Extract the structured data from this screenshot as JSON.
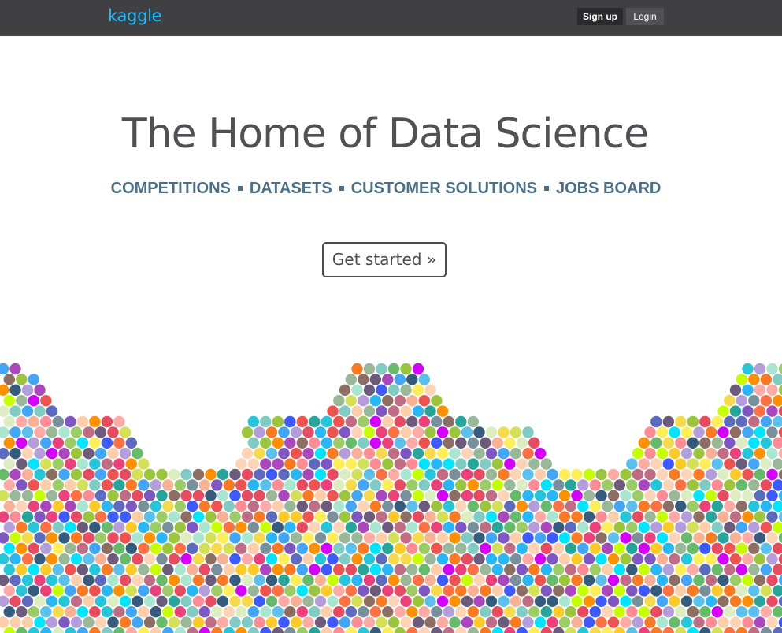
{
  "header": {
    "logo_text": "kaggle",
    "signup_label": "Sign up",
    "login_label": "Login",
    "brand_color": "#20beff",
    "bar_color": "#404043"
  },
  "hero": {
    "title": "The Home of Data Science",
    "nav_items": [
      "COMPETITIONS",
      "DATASETS",
      "CUSTOMER SOLUTIONS",
      "JOBS BOARD"
    ],
    "cta_label": "Get started »",
    "nav_color": "#4a6f86"
  },
  "decoration": {
    "name": "colorful-dot-hex-pattern",
    "palette": [
      "#e84a5f",
      "#f7d94c",
      "#5bc0eb",
      "#9bc53d",
      "#fa7921",
      "#c06c84",
      "#6c5b7b",
      "#355c7d",
      "#f8b195",
      "#99b898",
      "#feceab",
      "#a8e6cf",
      "#dcedc1",
      "#ffd3b6",
      "#ffaaa5",
      "#ff8b94",
      "#b39ddb",
      "#80cbc4",
      "#ef5350",
      "#42a5f5",
      "#66bb6a",
      "#ffee58",
      "#ab47bc",
      "#26c6da",
      "#d4e157",
      "#ff7043",
      "#8d6e63",
      "#78909c",
      "#ec407a",
      "#7e57c2",
      "#29b6f6",
      "#9ccc65",
      "#ffca28",
      "#5c6bc0",
      "#26a69a",
      "#d500f9",
      "#00e5ff",
      "#c6ff00",
      "#ff9100",
      "#3d5afe"
    ]
  }
}
